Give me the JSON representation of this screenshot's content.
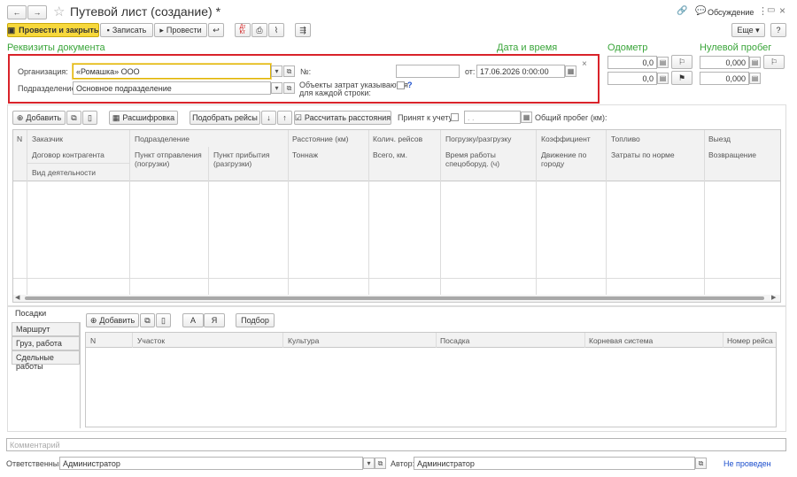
{
  "window": {
    "title": "Путевой лист (создание) *",
    "discussion": "Обсуждение"
  },
  "toolbar": {
    "post_close": "Провести и закрыть",
    "save": "Записать",
    "post": "Провести",
    "more": "Еще",
    "help": "?"
  },
  "sections": {
    "requisites": "Реквизиты документа",
    "datetime": "Дата и время",
    "odometer": "Одометр",
    "zero_run": "Нулевой пробег"
  },
  "form": {
    "org_label": "Организация:",
    "org_value": "«Ромашка» ООО",
    "dept_label": "Подразделение:",
    "dept_value": "Основное подразделение",
    "num_label": "№:",
    "num_value": "",
    "date_label": "от:",
    "date_value": "17.06.2026  0:00:00",
    "cost_label_1": "Объекты затрат указываются",
    "cost_label_2": "для каждой строки:",
    "cost_help": "?"
  },
  "odometer": {
    "v1": "0,0",
    "v2": "0,0"
  },
  "zero_run": {
    "v1": "0,000",
    "v2": "0,000"
  },
  "table_toolbar": {
    "add": "Добавить",
    "decode": "Расшифровка",
    "pick_trips": "Подобрать рейсы",
    "calc": "Рассчитать расстояния",
    "accepted": "Принят к учету:",
    "accepted_date": ". .",
    "total_run": "Общий пробег (км):"
  },
  "table_headers": {
    "row1": [
      "N",
      "Заказчик",
      "Подразделение",
      "Расстояние (км)",
      "Колич. рейсов",
      "Погрузку/разгрузку",
      "Коэффициент",
      "Топливо",
      "Выезд"
    ],
    "row2": [
      "Договор контрагента",
      "Пункт отправления (погрузки)",
      "Пункт прибытия (разгрузки)",
      "Тоннаж",
      "Всего, км.",
      "Время работы спецоборуд. (ч)",
      "Движение по городу",
      "Затраты по норме",
      "Возвращение"
    ],
    "row3": [
      "Вид деятельности"
    ]
  },
  "tabs": [
    "Посадки",
    "Маршрут",
    "Груз, работа",
    "Сдельные работы"
  ],
  "bottom_toolbar": {
    "add": "Добавить",
    "a": "А",
    "ya": "Я",
    "pick": "Подбор"
  },
  "bottom_headers": [
    "N",
    "Участок",
    "Культура",
    "Посадка",
    "Корневая система",
    "Номер рейса"
  ],
  "footer": {
    "comment_placeholder": "Комментарий",
    "responsible_label": "Ответственный:",
    "responsible_value": "Администратор",
    "author_label": "Автор:",
    "author_value": "Администратор",
    "status": "Не проведен"
  },
  "colors": {
    "highlight": "#d9232a",
    "green": "#3aa53a",
    "yellow": "#f7d83c",
    "status_blue": "#1a4dcc"
  }
}
